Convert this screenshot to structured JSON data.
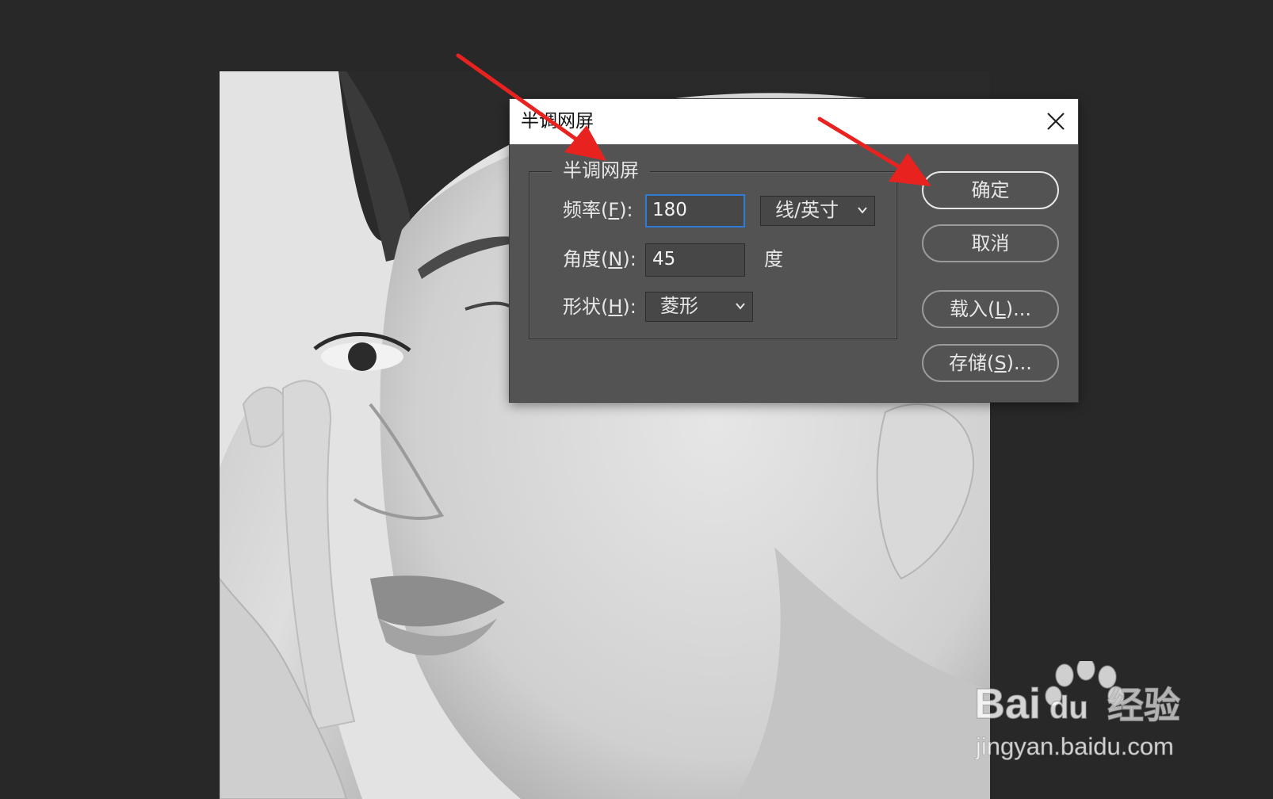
{
  "dialog": {
    "title": "半调网屏",
    "group_title": "半调网屏",
    "frequency": {
      "label_prefix": "频率(",
      "label_key": "F",
      "label_suffix": "):",
      "value": "180",
      "unit_selected": "线/英寸"
    },
    "angle": {
      "label_prefix": "角度(",
      "label_key": "N",
      "label_suffix": "):",
      "value": "45",
      "unit": "度"
    },
    "shape": {
      "label_prefix": "形状(",
      "label_key": "H",
      "label_suffix": "):",
      "selected": "菱形"
    },
    "buttons": {
      "ok": "确定",
      "cancel": "取消",
      "load_prefix": "载入(",
      "load_key": "L",
      "load_suffix": ")...",
      "save_prefix": "存储(",
      "save_key": "S",
      "save_suffix": ")..."
    }
  },
  "colors": {
    "workspace": "#282828",
    "dialog_bg": "#535353",
    "focus_blue": "#2f7bd6",
    "arrow_red": "#e8231f"
  },
  "icons": {
    "close": "close-icon",
    "dropdown": "chevron-down-icon"
  }
}
